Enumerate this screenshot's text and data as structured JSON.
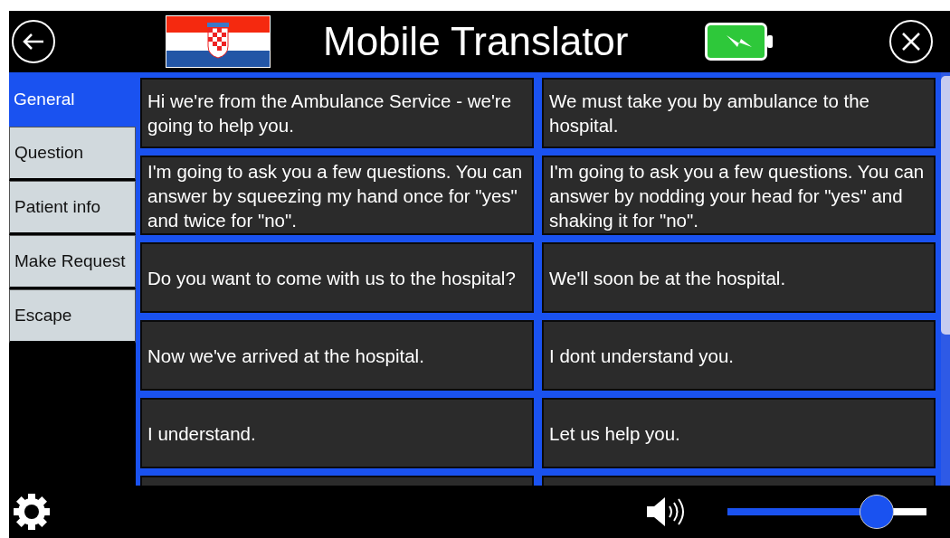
{
  "header": {
    "title": "Mobile Translator"
  },
  "categories": [
    {
      "label": "General",
      "selected": true
    },
    {
      "label": "Question",
      "selected": false
    },
    {
      "label": "Patient info",
      "selected": false
    },
    {
      "label": "Make Request",
      "selected": false
    },
    {
      "label": "Escape",
      "selected": false
    }
  ],
  "phrases": [
    "Hi we're from the Ambulance Service - we're going to help you.",
    "We must take you by ambulance to the hospital.",
    "I'm going to ask you a few questions. You can answer by squeezing my hand once for \"yes\" and twice for \"no\".",
    "I'm going to ask you a few questions. You can answer by nodding your head for \"yes\" and shaking it for \"no\".",
    "Do you want to come with us to the hospital?",
    "We'll soon be at the hospital.",
    "Now we've arrived at the hospital.",
    "I dont understand you.",
    "I understand.",
    "Let us help you."
  ],
  "volume": {
    "level": 0.75
  }
}
